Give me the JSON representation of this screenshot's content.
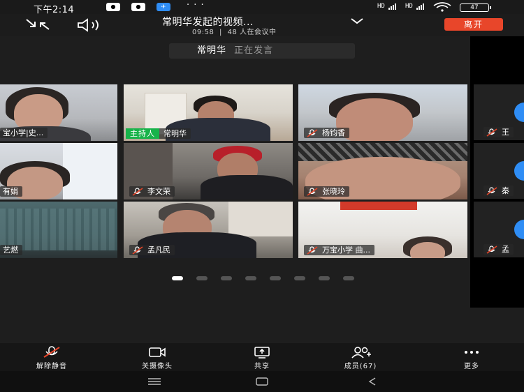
{
  "status_bar": {
    "time": "下午2:14",
    "app_icons": [
      "qq-penguin-icon",
      "qq-penguin-icon",
      "message-icon"
    ],
    "overflow": "· · ·",
    "signal_1": "HD",
    "signal_2": "HD",
    "battery": "47"
  },
  "header": {
    "title": "常明华发起的视频...",
    "duration": "09:58",
    "separator": "|",
    "attendees": "48 人在会议中",
    "leave_label": "离开"
  },
  "speaker_banner": {
    "name": "常明华",
    "status": "正在发言"
  },
  "participants": [
    {
      "name": "宝小学|史...",
      "host": false
    },
    {
      "name": "常明华",
      "host": true,
      "host_label": "主持人"
    },
    {
      "name": "杨钧香",
      "host": false
    },
    {
      "name": "王",
      "host": false
    },
    {
      "name": "有娟",
      "host": false
    },
    {
      "name": "李文荣",
      "host": false
    },
    {
      "name": "张晓玲",
      "host": false
    },
    {
      "name": "秦",
      "host": false
    },
    {
      "name": "艺燃",
      "host": false
    },
    {
      "name": "孟凡民",
      "host": false
    },
    {
      "name": "万宝小学  曲...",
      "host": false
    },
    {
      "name": "孟",
      "host": false
    }
  ],
  "pagination": {
    "pages": 8,
    "current": 1
  },
  "toolbar": {
    "unmute": "解除静音",
    "camera_off": "关摄像头",
    "share": "共享",
    "members": "成员(67)",
    "more": "更多"
  },
  "colors": {
    "accent_green": "#18b34a",
    "leave_red": "#e8462a",
    "muted_red": "#e8462a"
  }
}
